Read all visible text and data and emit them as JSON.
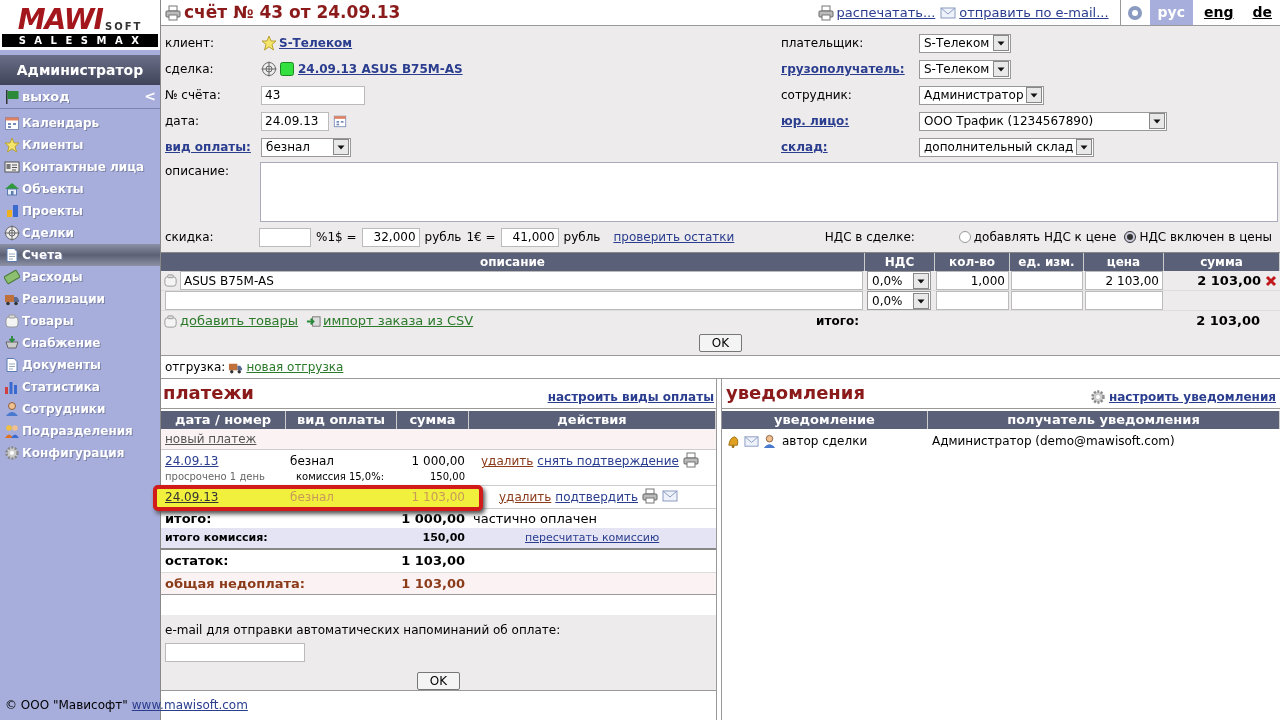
{
  "logo": {
    "brand": "MAWI",
    "suffix": "SOFT",
    "tagline": "SALESMAX"
  },
  "user": "Администратор",
  "logout": {
    "label": "выход",
    "collapse": "<"
  },
  "nav": [
    {
      "label": "Календарь",
      "selected": false
    },
    {
      "label": "Клиенты",
      "selected": false
    },
    {
      "label": "Контактные лица",
      "selected": false
    },
    {
      "label": "Объекты",
      "selected": false
    },
    {
      "label": "Проекты",
      "selected": false
    },
    {
      "label": "Сделки",
      "selected": false
    },
    {
      "label": "Счета",
      "selected": true
    },
    {
      "label": "Расходы",
      "selected": false
    },
    {
      "label": "Реализации",
      "selected": false
    },
    {
      "label": "Товары",
      "selected": false
    },
    {
      "label": "Снабжение",
      "selected": false
    },
    {
      "label": "Документы",
      "selected": false
    },
    {
      "label": "Статистика",
      "selected": false
    },
    {
      "label": "Сотрудники",
      "selected": false
    },
    {
      "label": "Подразделения",
      "selected": false
    },
    {
      "label": "Конфигурация",
      "selected": false
    }
  ],
  "title": "счёт № 43 от 24.09.13",
  "header_links": [
    {
      "kind": "print",
      "label": "распечатать..."
    },
    {
      "kind": "email",
      "label": "отправить по e-mail..."
    }
  ],
  "languages": [
    {
      "label": "рус",
      "selected": true
    },
    {
      "label": "eng",
      "selected": false
    },
    {
      "label": "de",
      "selected": false
    }
  ],
  "left_fields": [
    {
      "kind": "client",
      "label": "клиент:",
      "label_link": false,
      "value": "S-Телеком"
    },
    {
      "kind": "deal",
      "label": "сделка:",
      "label_link": false,
      "value": "24.09.13 ASUS B75M-AS"
    },
    {
      "kind": "input",
      "label": "№ счёта:",
      "label_link": false,
      "value": "43"
    },
    {
      "kind": "date",
      "label": "дата:",
      "label_link": false,
      "value": "24.09.13"
    },
    {
      "kind": "select",
      "label": "вид оплаты:",
      "label_link": true,
      "value": "безнал"
    }
  ],
  "right_fields": [
    {
      "label": "плательщик:",
      "label_link": false,
      "value": "S-Телеком"
    },
    {
      "label": "грузополучатель:",
      "label_link": true,
      "value": "S-Телеком"
    },
    {
      "label": "сотрудник:",
      "label_link": false,
      "value": "Администратор"
    },
    {
      "label": "юр. лицо:",
      "label_link": true,
      "value": "ООО Трафик (1234567890)"
    },
    {
      "label": "склад:",
      "label_link": true,
      "value": "дополнительный склад"
    }
  ],
  "description": {
    "label": "описание:"
  },
  "discount": {
    "label": "скидка:",
    "usd_label": "%1$ =",
    "usd": "32,000",
    "usd_unit": "рубль",
    "eur_label": "1€ =",
    "eur": "41,000",
    "eur_unit": "рубль",
    "check_link": "проверить остатки"
  },
  "vat": {
    "label": "НДС в сделке:",
    "options": [
      {
        "label": "добавлять НДС к цене",
        "selected": false
      },
      {
        "label": "НДС включен в цены",
        "selected": true
      }
    ]
  },
  "items": {
    "columns": [
      "описание",
      "НДС",
      "кол-во",
      "ед. изм.",
      "цена",
      "сумма"
    ],
    "rows": [
      {
        "description": "ASUS B75M-AS",
        "vat": "0,0%",
        "qty": "1,000",
        "price": "2 103,00",
        "sum": "2 103,00"
      },
      {
        "vat": "0,0%"
      }
    ],
    "add_link": "добавить товары",
    "import_link": "импорт заказа из CSV",
    "total_label": "итого:",
    "total": "2 103,00",
    "ok": "OK"
  },
  "shipment": {
    "label": "отгрузка:",
    "link": "новая отгрузка"
  },
  "payments": {
    "title": "платежи",
    "settings_link": "настроить виды оплаты",
    "columns": [
      "дата / номер",
      "вид оплаты",
      "сумма",
      "действия"
    ],
    "new_link": "новый платеж",
    "rows": [
      {
        "date": "24.09.13",
        "overdue": "просрочено 1 день",
        "type": "безнал",
        "commission_label": "комиссия 15,0%:",
        "amount": "1 000,00",
        "commission": "150,00",
        "actions": [
          "удалить",
          "снять подтверждение"
        ],
        "confirmed": true,
        "highlighted": false
      },
      {
        "date": "24.09.13",
        "type": "безнал",
        "amount": "1 103,00",
        "actions": [
          "удалить",
          "подтвердить"
        ],
        "confirmed": false,
        "highlighted": true
      }
    ],
    "totals": [
      {
        "kind": "total",
        "label": "итого:",
        "value": "1 000,00",
        "note": "частично оплачен"
      },
      {
        "kind": "commission",
        "label": "итого комиссия:",
        "value": "150,00",
        "link": "пересчитать комиссию"
      },
      {
        "kind": "balance",
        "label": "остаток:",
        "value": "1 103,00"
      },
      {
        "kind": "underpaid",
        "label": "общая недоплата:",
        "value": "1 103,00"
      }
    ],
    "email_label": "e-mail для отправки автоматических напоминаний об оплате:",
    "ok": "OK"
  },
  "notifications": {
    "title": "уведомления",
    "settings_link": "настроить уведомления",
    "columns": [
      "уведомление",
      "получатель уведомления"
    ],
    "rows": [
      {
        "event": "автор сделки",
        "recipient": "Администратор (demo@mawisoft.com)"
      }
    ]
  },
  "footer": {
    "copyright": "© ООО \"Мависофт\"",
    "link": "www.mawisoft.com"
  }
}
